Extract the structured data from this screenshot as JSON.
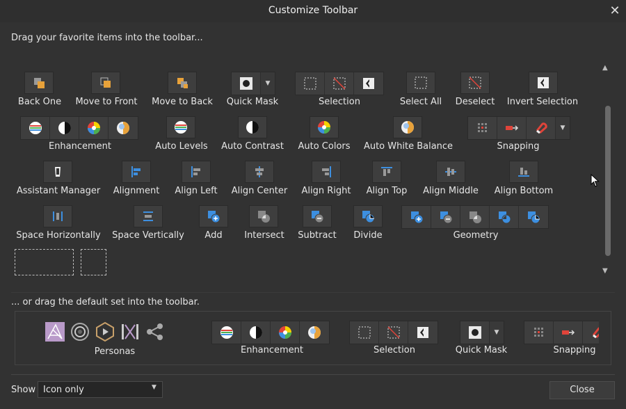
{
  "window": {
    "title": "Customize Toolbar",
    "close_glyph": "✕"
  },
  "instructions": {
    "drag_favorites": "Drag your favorite items into the toolbar...",
    "drag_default": "... or drag the default set into the toolbar."
  },
  "items": {
    "back_one": "Back One",
    "move_to_front": "Move to Front",
    "move_to_back": "Move to Back",
    "quick_mask": "Quick Mask",
    "selection": "Selection",
    "select_all": "Select All",
    "deselect": "Deselect",
    "invert_selection": "Invert Selection",
    "enhancement": "Enhancement",
    "auto_levels": "Auto Levels",
    "auto_contrast": "Auto Contrast",
    "auto_colors": "Auto Colors",
    "auto_white_balance": "Auto White Balance",
    "snapping": "Snapping",
    "assistant_manager": "Assistant Manager",
    "alignment": "Alignment",
    "align_left": "Align Left",
    "align_center": "Align Center",
    "align_right": "Align Right",
    "align_top": "Align Top",
    "align_middle": "Align Middle",
    "align_bottom": "Align Bottom",
    "space_horizontally": "Space Horizontally",
    "space_vertically": "Space Vertically",
    "add": "Add",
    "intersect": "Intersect",
    "subtract": "Subtract",
    "divide": "Divide",
    "geometry": "Geometry"
  },
  "default_set": {
    "personas": "Personas",
    "enhancement": "Enhancement",
    "selection": "Selection",
    "quick_mask": "Quick Mask",
    "snapping": "Snapping"
  },
  "footer": {
    "show_label": "Show",
    "show_value": "Icon only",
    "close_label": "Close"
  },
  "colors": {
    "background": "#323232",
    "tile": "#3e3e3e",
    "accent_blue": "#3d8fe0",
    "accent_orange": "#e8a23a",
    "accent_red": "#e0443a"
  }
}
